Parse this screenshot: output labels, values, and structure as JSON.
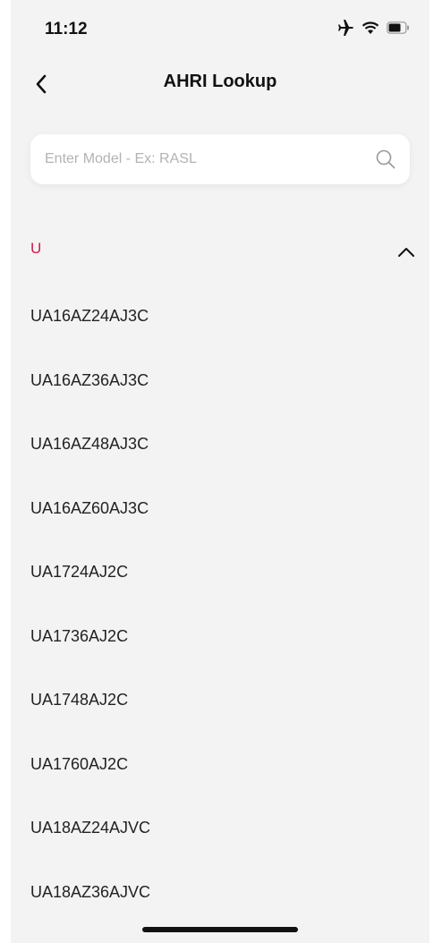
{
  "status_bar": {
    "time": "11:12"
  },
  "nav": {
    "title": "AHRI Lookup"
  },
  "search": {
    "placeholder": "Enter Model - Ex: RASL"
  },
  "section": {
    "letter": "U"
  },
  "models": [
    "UA16AZ24AJ3C",
    "UA16AZ36AJ3C",
    "UA16AZ48AJ3C",
    "UA16AZ60AJ3C",
    "UA1724AJ2C",
    "UA1736AJ2C",
    "UA1748AJ2C",
    "UA1760AJ2C",
    "UA18AZ24AJVC",
    "UA18AZ36AJVC"
  ],
  "colors": {
    "accent": "#d31a48",
    "background": "#f3f3f3"
  }
}
